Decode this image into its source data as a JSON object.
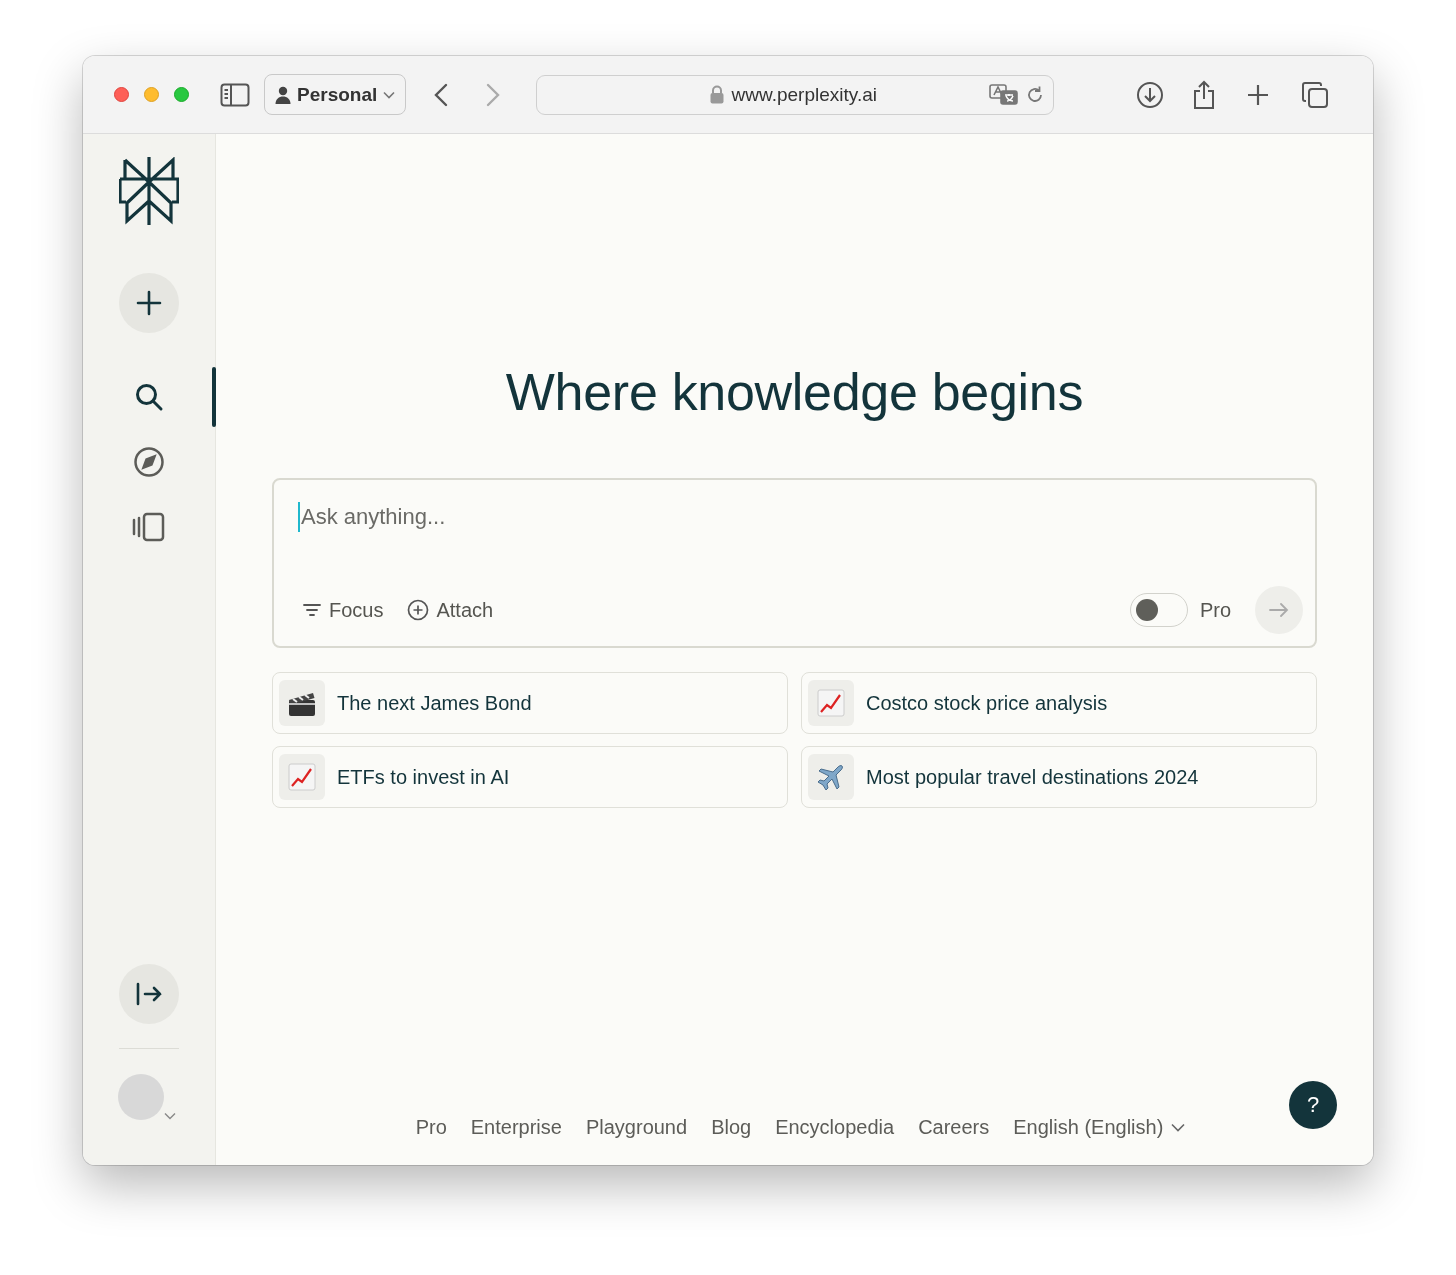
{
  "browser": {
    "profile": "Personal",
    "back_disabled": false,
    "forward_disabled": true,
    "url": "www.perplexity.ai"
  },
  "sidebar": {
    "items": [
      {
        "kind": "search",
        "selected": true
      },
      {
        "kind": "discover",
        "selected": false
      },
      {
        "kind": "library",
        "selected": false
      }
    ]
  },
  "heading": "Where knowledge begins",
  "search": {
    "placeholder": "Ask anything...",
    "focus": "Focus",
    "attach": "Attach",
    "pro_label": "Pro",
    "pro_on": false,
    "submit_disabled": true
  },
  "suggestions": [
    {
      "kind": "film",
      "label": "The next James Bond"
    },
    {
      "kind": "chart",
      "label": "Costco stock price analysis"
    },
    {
      "kind": "chart",
      "label": "ETFs to invest in AI"
    },
    {
      "kind": "travel",
      "label": "Most popular travel destinations 2024"
    }
  ],
  "footer": {
    "links": [
      "Pro",
      "Enterprise",
      "Playground",
      "Blog",
      "Encyclopedia",
      "Careers"
    ],
    "language": "English (English)"
  },
  "help": "?"
}
